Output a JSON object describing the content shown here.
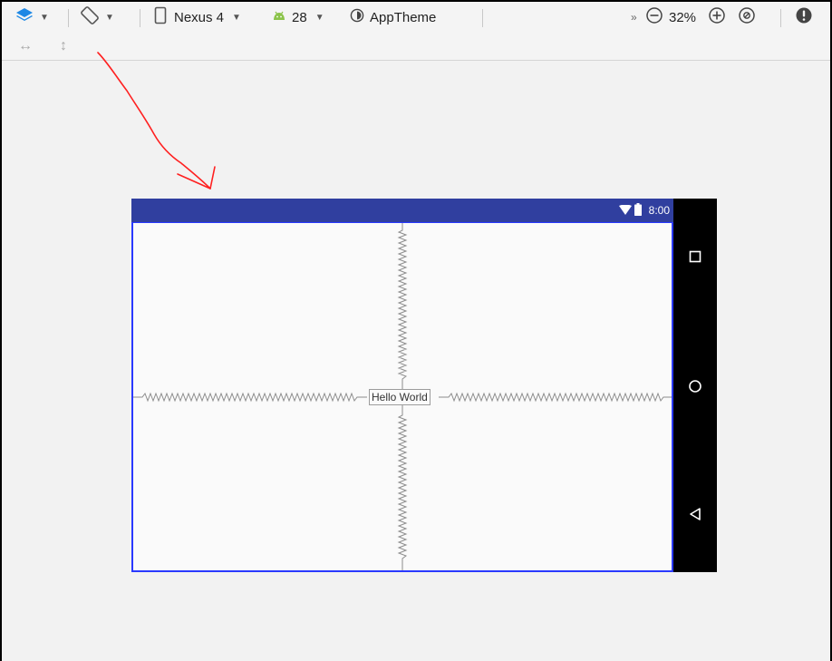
{
  "toolbar": {
    "device_label": "Nexus 4",
    "api_label": "28",
    "theme_label": "AppTheme",
    "overflow_label": "»",
    "zoom_label": "32%"
  },
  "preview": {
    "status_time": "8:00",
    "hello_text": "Hello World"
  },
  "colors": {
    "status_bar": "#303f9f",
    "selection_border": "#2a39ff",
    "layers_icon": "#1e88e5",
    "android_icon": "#8bc34a",
    "annotation_arrow": "#ff0000"
  },
  "icons": {
    "layers": "layers-icon",
    "orientation": "orientation-icon",
    "device": "phone-icon",
    "api": "android-icon",
    "theme": "theme-icon",
    "zoom_out": "zoom-out-icon",
    "zoom_in": "zoom-in-icon",
    "zoom_fit": "zoom-fit-icon",
    "warning": "warning-icon",
    "resize_h": "resize-horizontal-icon",
    "resize_v": "resize-vertical-icon",
    "recents": "recents-icon",
    "home": "home-icon",
    "back": "back-icon",
    "wifi": "wifi-icon",
    "battery": "battery-icon"
  }
}
